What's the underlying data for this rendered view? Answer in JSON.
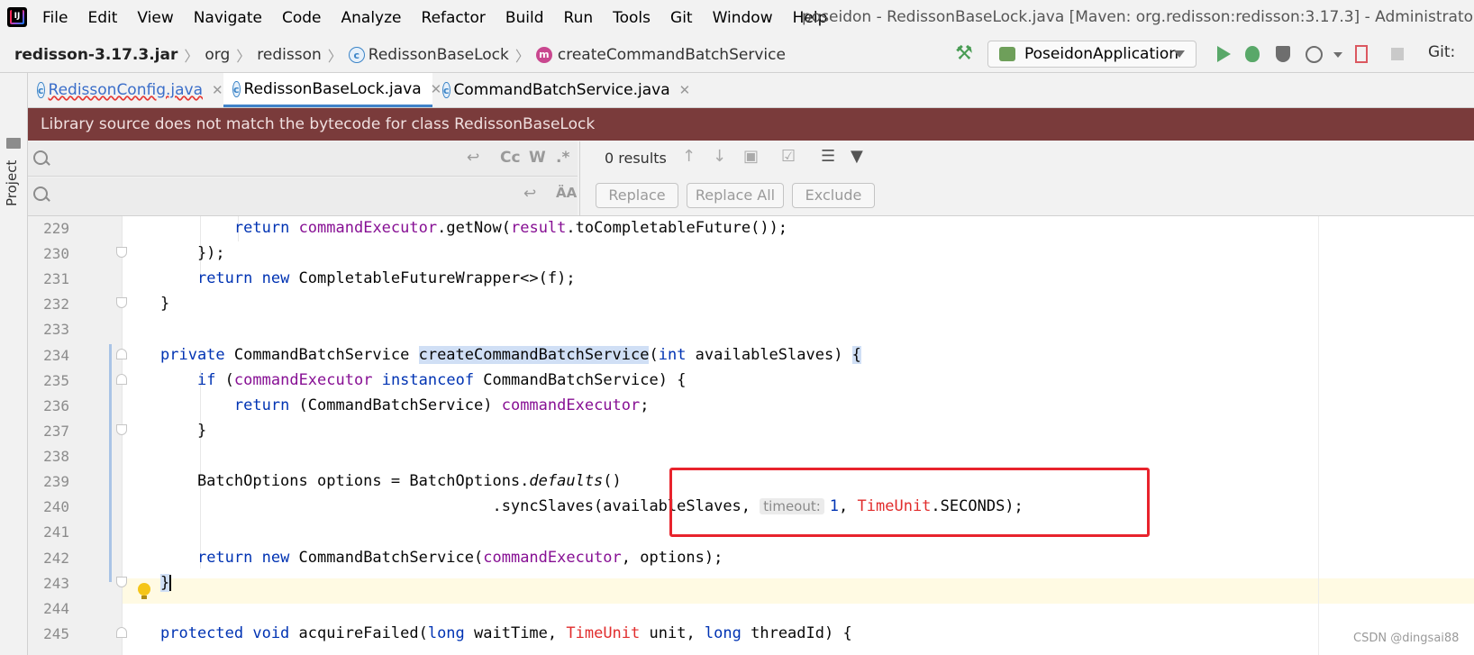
{
  "menubar": {
    "items": [
      "File",
      "Edit",
      "View",
      "Navigate",
      "Code",
      "Analyze",
      "Refactor",
      "Build",
      "Run",
      "Tools",
      "Git",
      "Window",
      "Help"
    ],
    "window_title": "poseidon - RedissonBaseLock.java [Maven: org.redisson:redisson:3.17.3] - Administrator"
  },
  "breadcrumb": {
    "jar": "redisson-3.17.3.jar",
    "pkg1": "org",
    "pkg2": "redisson",
    "class_icon": "c-icon",
    "class_name": "RedissonBaseLock",
    "method_icon": "m-icon",
    "method_name": "createCommandBatchService"
  },
  "toolbar": {
    "run_config": "PoseidonApplication",
    "git_label": "Git:"
  },
  "left_strip": {
    "project_label": "Project"
  },
  "tabs": [
    {
      "label": "RedissonConfig.java",
      "active": false
    },
    {
      "label": "RedissonBaseLock.java",
      "active": true
    },
    {
      "label": "CommandBatchService.java",
      "active": false
    }
  ],
  "banner": {
    "text": "Library source does not match the bytecode for class RedissonBaseLock"
  },
  "find": {
    "search_value": "",
    "replace_value": "",
    "opt_case": "Cc",
    "opt_words": "W",
    "opt_regex": ".*",
    "results": "0 results",
    "replace_label": "Replace",
    "replace_all_label": "Replace All",
    "exclude_label": "Exclude"
  },
  "editor": {
    "line_numbers": [
      "229",
      "230",
      "231",
      "232",
      "233",
      "234",
      "235",
      "236",
      "237",
      "238",
      "239",
      "240",
      "241",
      "242",
      "243",
      "244",
      "245"
    ],
    "hint_timeout": "timeout:",
    "current_line": "243",
    "colors": {
      "keyword": "#0033b3",
      "field": "#871094",
      "type_red": "#e12d2d",
      "highlight": "#d0dff5"
    }
  },
  "watermark": "CSDN @dingsai88"
}
